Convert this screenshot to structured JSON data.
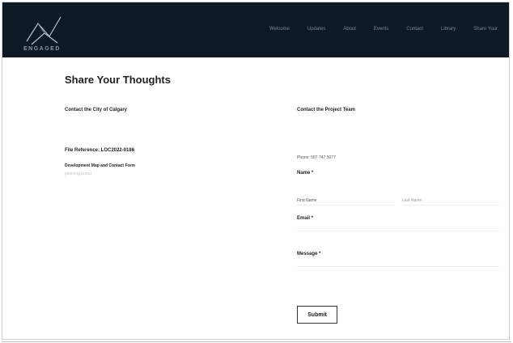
{
  "header": {
    "logo_text": "ENGAGED",
    "nav": [
      "Welcome",
      "Updates",
      "About",
      "Events",
      "Contact",
      "Library",
      "Share Your"
    ]
  },
  "page": {
    "title": "Share Your Thoughts"
  },
  "left": {
    "heading": "Contact the City of Calgary",
    "file_reference": "File Reference: LOC2022-0186",
    "map_link": "Development Map and Contact Form",
    "sub_note": "planning portal"
  },
  "right": {
    "heading": "Contact the Project Team",
    "phone": "Phone: 587 747 5077",
    "name_label": "Name *",
    "first_name_placeholder": "First Name",
    "last_name_placeholder": "Last Name",
    "email_label": "Email *",
    "message_label": "Message *",
    "submit_label": "Submit"
  }
}
